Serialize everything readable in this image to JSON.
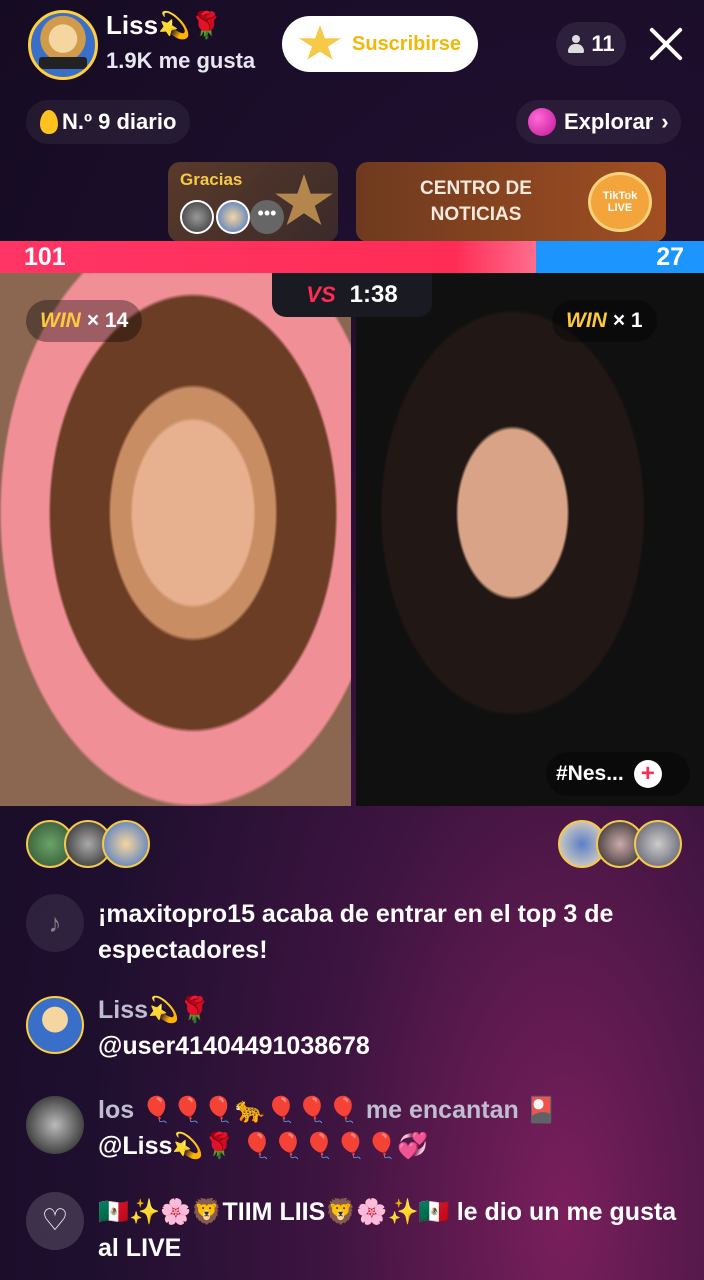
{
  "header": {
    "host_name": "Liss💫🌹",
    "likes": "1.9K me gusta",
    "subscribe_label": "Suscribirse",
    "viewer_count": "11",
    "rank_label": "N.º 9 diario",
    "explore_label": "Explorar"
  },
  "banners": {
    "thanks_label": "Gracias",
    "more": "•••",
    "news_title": "CENTRO DE NOTICIAS",
    "news_logo": "TikTok LIVE"
  },
  "battle": {
    "score_left": "101",
    "score_right": "27",
    "vs": "VS",
    "timer": "1:38",
    "left_win_word": "WIN",
    "left_win_count": "× 14",
    "right_win_word": "WIN",
    "right_win_count": "× 1",
    "right_tag": "#Nes..."
  },
  "chat": {
    "system_message": "¡maxitopro15 acaba de entrar en el top 3 de espectadores!",
    "messages": [
      {
        "user": "Liss💫🌹",
        "text": "@user41404491038678"
      },
      {
        "user": "los 🎈🎈🎈🐆🎈🎈🎈 me encantan 🎴",
        "text": "@Liss💫🌹 🎈🎈🎈🎈🎈💞"
      }
    ],
    "like_event": "🇲🇽✨🌸🦁TIIM LIIS🦁🌸✨🇲🇽 le dio un me gusta al LIVE"
  },
  "colors": {
    "accent_red": "#ff2d55",
    "accent_blue": "#1c95ff",
    "gold": "#ffc93c"
  },
  "icons": [
    "person-icon",
    "close-icon",
    "fire-icon",
    "planet-icon",
    "star-icon",
    "vs-icon",
    "plus-icon",
    "tiktok-icon",
    "heart-icon"
  ]
}
